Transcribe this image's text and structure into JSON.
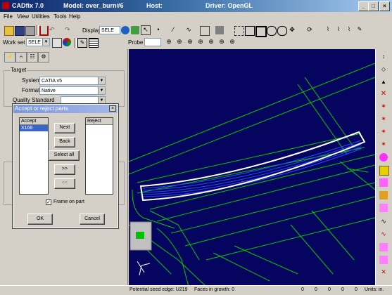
{
  "window": {
    "app_title": "CADfix 7.0",
    "model_label": "Model: over_burn#6",
    "host_label": "Host:",
    "driver_label": "Driver: OpenGL"
  },
  "menu": [
    "File",
    "View",
    "Utilities",
    "Tools",
    "Help"
  ],
  "toolbar1": {
    "display_label": "Display",
    "display_value": "SELE"
  },
  "toolbar2": {
    "workset_label": "Work set",
    "workset_value": "SELE",
    "probe_label": "Probe"
  },
  "left_panel": {
    "target_group": "Target",
    "system_label": "System",
    "system_value": "CATIA v5",
    "format_label": "Format",
    "format_value": "Native",
    "quality_label": "Quality Standard",
    "quality_value": ""
  },
  "dialog": {
    "title": "Accept or reject parts",
    "accept_header": "Accept",
    "reject_header": "Reject",
    "accept_items": [
      "X168"
    ],
    "next_button": "Next",
    "back_button": "Back",
    "select_all_button": "Select all",
    "move_right_button": ">>",
    "move_left_button": "<<",
    "frame_on_part_label": "Frame on part",
    "frame_on_part_checked": true,
    "ok_button": "OK",
    "cancel_button": "Cancel"
  },
  "status": {
    "message": "Potential seed edge: U219",
    "faces_label": "Faces in growth: 0",
    "counters": [
      "0",
      "0",
      "0",
      "0",
      "0"
    ],
    "units_label": "Units: in."
  },
  "colors": {
    "viewport_bg": "#050560",
    "wire_green": "#00c800",
    "highlight_blue": "#2848ff",
    "titlebar_start": "#0a246a"
  }
}
